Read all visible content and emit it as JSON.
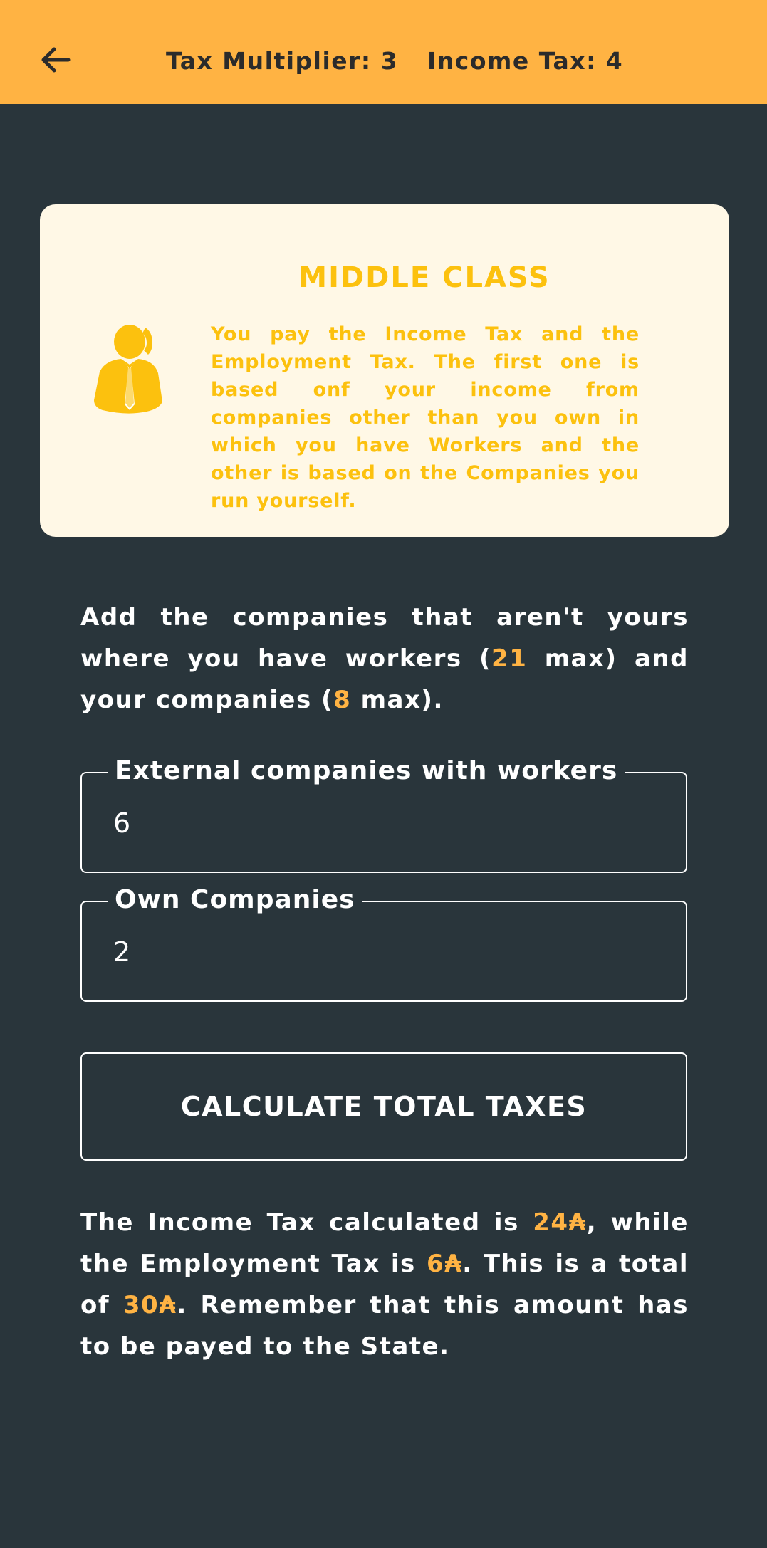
{
  "header": {
    "back_icon": "arrow-left-icon",
    "tax_multiplier_label": "Tax Multiplier: ",
    "tax_multiplier_value": "3",
    "income_tax_label": "Income Tax: ",
    "income_tax_value": "4"
  },
  "card": {
    "icon": "businessman-phone-icon",
    "title": "MIDDLE CLASS",
    "description": "You pay the Income Tax and the Employment Tax. The first one is based onf your income from companies other than you own in which you have Workers and the other is based on the Companies you run yourself."
  },
  "intro": {
    "part1": "Add the companies that aren't yours where you have workers (",
    "max_external": "21",
    "part2": " max) and your companies (",
    "max_own": "8",
    "part3": " max)."
  },
  "form": {
    "external_label": "External companies with workers",
    "external_value": "6",
    "own_label": "Own Companies",
    "own_value": "2",
    "calculate_label": "CALCULATE TOTAL TAXES"
  },
  "result": {
    "part1": "The Income Tax calculated is ",
    "income_tax": "24₳",
    "part2": ", while the Employment Tax is ",
    "employment_tax": "6₳",
    "part3": ". This is a total of ",
    "total": "30₳",
    "part4": ". Remember that this amount has to be payed to the State."
  },
  "colors": {
    "header_bg": "#ffb343",
    "page_bg": "#29353b",
    "card_bg": "#fff8e6",
    "accent_yellow": "#fcc10e",
    "highlight": "#ffb343"
  }
}
